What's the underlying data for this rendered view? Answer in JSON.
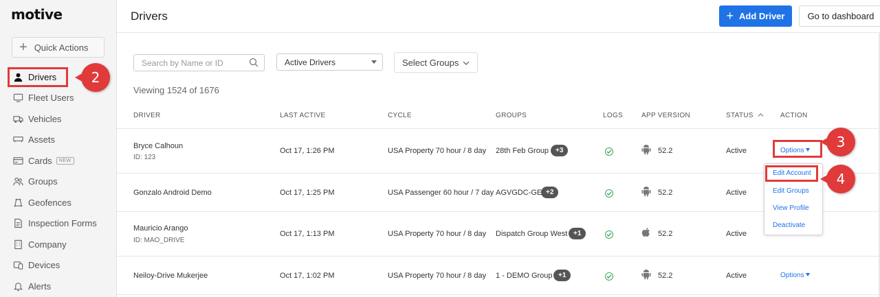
{
  "sidebar": {
    "logo": "motive",
    "quick_actions": "Quick Actions",
    "items": [
      {
        "label": "Drivers",
        "icon": "person-icon",
        "active": true
      },
      {
        "label": "Fleet Users",
        "icon": "monitor-icon"
      },
      {
        "label": "Vehicles",
        "icon": "truck-icon"
      },
      {
        "label": "Assets",
        "icon": "trailer-icon"
      },
      {
        "label": "Cards",
        "icon": "card-icon",
        "badge": "NEW"
      },
      {
        "label": "Groups",
        "icon": "people-icon"
      },
      {
        "label": "Geofences",
        "icon": "geofence-icon"
      },
      {
        "label": "Inspection Forms",
        "icon": "document-icon"
      },
      {
        "label": "Company",
        "icon": "building-icon"
      },
      {
        "label": "Devices",
        "icon": "device-icon"
      },
      {
        "label": "Alerts",
        "icon": "bell-icon"
      }
    ]
  },
  "header": {
    "title": "Drivers",
    "add_driver": "Add Driver",
    "go_dashboard": "Go to dashboard"
  },
  "filters": {
    "search_placeholder": "Search by Name or ID",
    "status_select": "Active Drivers",
    "groups_select": "Select Groups"
  },
  "viewing": "Viewing 1524 of 1676",
  "table": {
    "columns": [
      "DRIVER",
      "LAST ACTIVE",
      "CYCLE",
      "GROUPS",
      "LOGS",
      "APP VERSION",
      "STATUS",
      "ACTION"
    ],
    "rows": [
      {
        "name": "Bryce Calhoun",
        "id": "ID: 123",
        "last_active": "Oct 17, 1:26 PM",
        "cycle": "USA Property 70 hour / 8 day",
        "group": "28th Feb Group",
        "extra": "+3",
        "os": "android",
        "version": "52.2",
        "status": "Active",
        "action": "Options"
      },
      {
        "name": "Gonzalo Android Demo",
        "id": "",
        "last_active": "Oct 17, 1:25 PM",
        "cycle": "USA Passenger 60 hour / 7 day",
        "group": "AGVGDC-GE",
        "extra": "+2",
        "os": "android",
        "version": "52.2",
        "status": "Active",
        "action": ""
      },
      {
        "name": "Mauricio Arango",
        "id": "ID: MAO_DRIVE",
        "last_active": "Oct 17, 1:13 PM",
        "cycle": "USA Property 70 hour / 8 day",
        "group": "Dispatch Group West",
        "extra": "+1",
        "os": "apple",
        "version": "52.2",
        "status": "Active",
        "action": ""
      },
      {
        "name": "Neiloy-Drive Mukerjee",
        "id": "",
        "last_active": "Oct 17, 1:02 PM",
        "cycle": "USA Property 70 hour / 8 day",
        "group": "1 - DEMO Group",
        "extra": "+1",
        "os": "android",
        "version": "52.2",
        "status": "Active",
        "action": "Options"
      }
    ]
  },
  "dropdown": {
    "items": [
      "Edit Account",
      "Edit Groups",
      "View Profile",
      "Deactivate"
    ]
  },
  "steps": [
    "2",
    "3",
    "4"
  ],
  "colors": {
    "accent": "#1f73e6",
    "annotation": "#e03a3a",
    "success": "#3aa55a"
  }
}
